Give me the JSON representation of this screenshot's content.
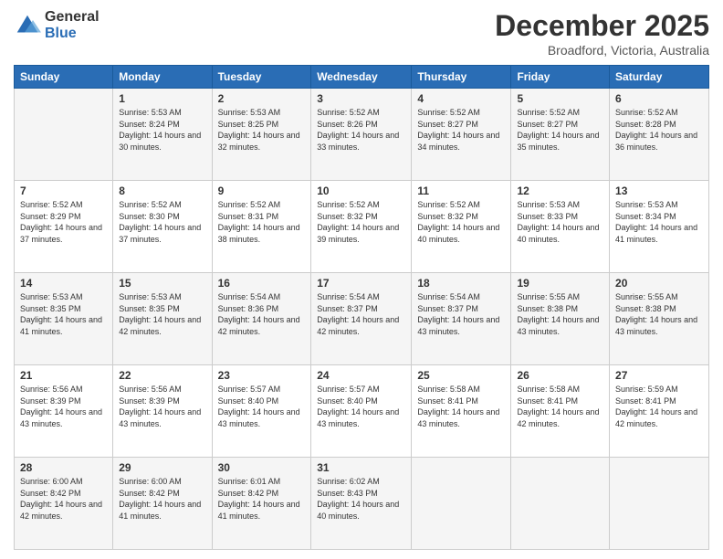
{
  "logo": {
    "general": "General",
    "blue": "Blue"
  },
  "header": {
    "month": "December 2025",
    "location": "Broadford, Victoria, Australia"
  },
  "days_of_week": [
    "Sunday",
    "Monday",
    "Tuesday",
    "Wednesday",
    "Thursday",
    "Friday",
    "Saturday"
  ],
  "weeks": [
    [
      {
        "day": "",
        "sunrise": "",
        "sunset": "",
        "daylight": ""
      },
      {
        "day": "1",
        "sunrise": "Sunrise: 5:53 AM",
        "sunset": "Sunset: 8:24 PM",
        "daylight": "Daylight: 14 hours and 30 minutes."
      },
      {
        "day": "2",
        "sunrise": "Sunrise: 5:53 AM",
        "sunset": "Sunset: 8:25 PM",
        "daylight": "Daylight: 14 hours and 32 minutes."
      },
      {
        "day": "3",
        "sunrise": "Sunrise: 5:52 AM",
        "sunset": "Sunset: 8:26 PM",
        "daylight": "Daylight: 14 hours and 33 minutes."
      },
      {
        "day": "4",
        "sunrise": "Sunrise: 5:52 AM",
        "sunset": "Sunset: 8:27 PM",
        "daylight": "Daylight: 14 hours and 34 minutes."
      },
      {
        "day": "5",
        "sunrise": "Sunrise: 5:52 AM",
        "sunset": "Sunset: 8:27 PM",
        "daylight": "Daylight: 14 hours and 35 minutes."
      },
      {
        "day": "6",
        "sunrise": "Sunrise: 5:52 AM",
        "sunset": "Sunset: 8:28 PM",
        "daylight": "Daylight: 14 hours and 36 minutes."
      }
    ],
    [
      {
        "day": "7",
        "sunrise": "Sunrise: 5:52 AM",
        "sunset": "Sunset: 8:29 PM",
        "daylight": "Daylight: 14 hours and 37 minutes."
      },
      {
        "day": "8",
        "sunrise": "Sunrise: 5:52 AM",
        "sunset": "Sunset: 8:30 PM",
        "daylight": "Daylight: 14 hours and 37 minutes."
      },
      {
        "day": "9",
        "sunrise": "Sunrise: 5:52 AM",
        "sunset": "Sunset: 8:31 PM",
        "daylight": "Daylight: 14 hours and 38 minutes."
      },
      {
        "day": "10",
        "sunrise": "Sunrise: 5:52 AM",
        "sunset": "Sunset: 8:32 PM",
        "daylight": "Daylight: 14 hours and 39 minutes."
      },
      {
        "day": "11",
        "sunrise": "Sunrise: 5:52 AM",
        "sunset": "Sunset: 8:32 PM",
        "daylight": "Daylight: 14 hours and 40 minutes."
      },
      {
        "day": "12",
        "sunrise": "Sunrise: 5:53 AM",
        "sunset": "Sunset: 8:33 PM",
        "daylight": "Daylight: 14 hours and 40 minutes."
      },
      {
        "day": "13",
        "sunrise": "Sunrise: 5:53 AM",
        "sunset": "Sunset: 8:34 PM",
        "daylight": "Daylight: 14 hours and 41 minutes."
      }
    ],
    [
      {
        "day": "14",
        "sunrise": "Sunrise: 5:53 AM",
        "sunset": "Sunset: 8:35 PM",
        "daylight": "Daylight: 14 hours and 41 minutes."
      },
      {
        "day": "15",
        "sunrise": "Sunrise: 5:53 AM",
        "sunset": "Sunset: 8:35 PM",
        "daylight": "Daylight: 14 hours and 42 minutes."
      },
      {
        "day": "16",
        "sunrise": "Sunrise: 5:54 AM",
        "sunset": "Sunset: 8:36 PM",
        "daylight": "Daylight: 14 hours and 42 minutes."
      },
      {
        "day": "17",
        "sunrise": "Sunrise: 5:54 AM",
        "sunset": "Sunset: 8:37 PM",
        "daylight": "Daylight: 14 hours and 42 minutes."
      },
      {
        "day": "18",
        "sunrise": "Sunrise: 5:54 AM",
        "sunset": "Sunset: 8:37 PM",
        "daylight": "Daylight: 14 hours and 43 minutes."
      },
      {
        "day": "19",
        "sunrise": "Sunrise: 5:55 AM",
        "sunset": "Sunset: 8:38 PM",
        "daylight": "Daylight: 14 hours and 43 minutes."
      },
      {
        "day": "20",
        "sunrise": "Sunrise: 5:55 AM",
        "sunset": "Sunset: 8:38 PM",
        "daylight": "Daylight: 14 hours and 43 minutes."
      }
    ],
    [
      {
        "day": "21",
        "sunrise": "Sunrise: 5:56 AM",
        "sunset": "Sunset: 8:39 PM",
        "daylight": "Daylight: 14 hours and 43 minutes."
      },
      {
        "day": "22",
        "sunrise": "Sunrise: 5:56 AM",
        "sunset": "Sunset: 8:39 PM",
        "daylight": "Daylight: 14 hours and 43 minutes."
      },
      {
        "day": "23",
        "sunrise": "Sunrise: 5:57 AM",
        "sunset": "Sunset: 8:40 PM",
        "daylight": "Daylight: 14 hours and 43 minutes."
      },
      {
        "day": "24",
        "sunrise": "Sunrise: 5:57 AM",
        "sunset": "Sunset: 8:40 PM",
        "daylight": "Daylight: 14 hours and 43 minutes."
      },
      {
        "day": "25",
        "sunrise": "Sunrise: 5:58 AM",
        "sunset": "Sunset: 8:41 PM",
        "daylight": "Daylight: 14 hours and 43 minutes."
      },
      {
        "day": "26",
        "sunrise": "Sunrise: 5:58 AM",
        "sunset": "Sunset: 8:41 PM",
        "daylight": "Daylight: 14 hours and 42 minutes."
      },
      {
        "day": "27",
        "sunrise": "Sunrise: 5:59 AM",
        "sunset": "Sunset: 8:41 PM",
        "daylight": "Daylight: 14 hours and 42 minutes."
      }
    ],
    [
      {
        "day": "28",
        "sunrise": "Sunrise: 6:00 AM",
        "sunset": "Sunset: 8:42 PM",
        "daylight": "Daylight: 14 hours and 42 minutes."
      },
      {
        "day": "29",
        "sunrise": "Sunrise: 6:00 AM",
        "sunset": "Sunset: 8:42 PM",
        "daylight": "Daylight: 14 hours and 41 minutes."
      },
      {
        "day": "30",
        "sunrise": "Sunrise: 6:01 AM",
        "sunset": "Sunset: 8:42 PM",
        "daylight": "Daylight: 14 hours and 41 minutes."
      },
      {
        "day": "31",
        "sunrise": "Sunrise: 6:02 AM",
        "sunset": "Sunset: 8:43 PM",
        "daylight": "Daylight: 14 hours and 40 minutes."
      },
      {
        "day": "",
        "sunrise": "",
        "sunset": "",
        "daylight": ""
      },
      {
        "day": "",
        "sunrise": "",
        "sunset": "",
        "daylight": ""
      },
      {
        "day": "",
        "sunrise": "",
        "sunset": "",
        "daylight": ""
      }
    ]
  ]
}
